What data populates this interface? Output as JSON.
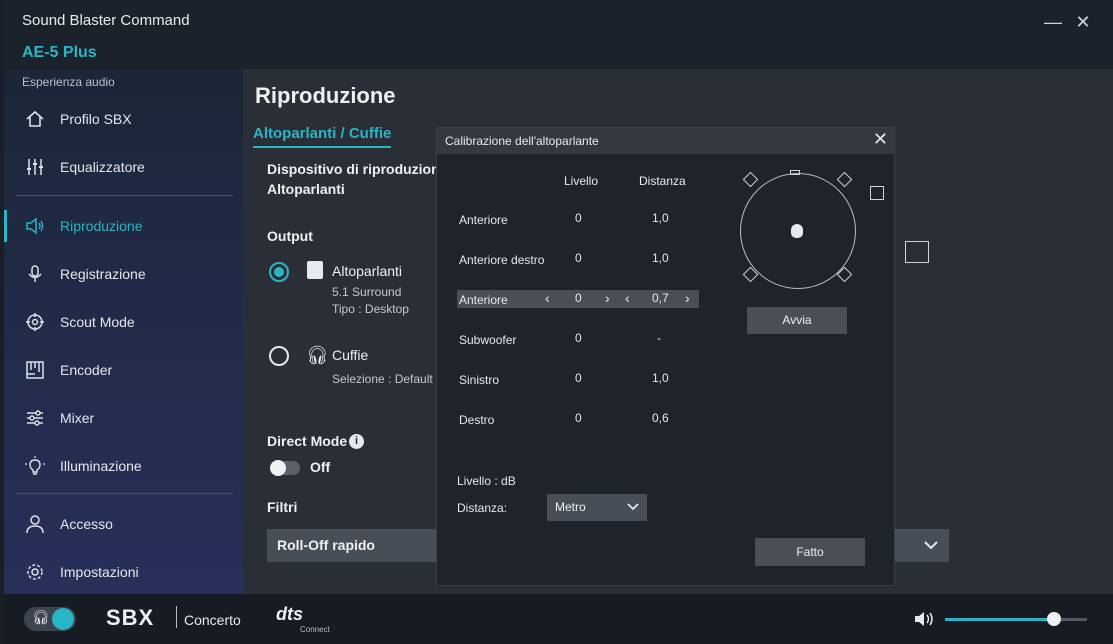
{
  "app": {
    "title": "Sound Blaster Command",
    "device": "AE-5 Plus",
    "minimize_glyph": "—",
    "close_glyph": "✕"
  },
  "sidebar": {
    "section_label": "Esperienza audio",
    "items": [
      {
        "label": "Profilo SBX",
        "icon": "home-icon"
      },
      {
        "label": "Equalizzatore",
        "icon": "equalizer-icon"
      },
      {
        "label": "Riproduzione",
        "icon": "speaker-icon",
        "active": true
      },
      {
        "label": "Registrazione",
        "icon": "microphone-icon"
      },
      {
        "label": "Scout Mode",
        "icon": "crosshair-icon"
      },
      {
        "label": "Encoder",
        "icon": "encoder-icon"
      },
      {
        "label": "Mixer",
        "icon": "mixer-icon"
      },
      {
        "label": "Illuminazione",
        "icon": "lightbulb-icon"
      },
      {
        "label": "Accesso",
        "icon": "user-icon"
      },
      {
        "label": "Impostazioni",
        "icon": "gear-icon"
      }
    ]
  },
  "main": {
    "title": "Riproduzione",
    "tab_active": "Altoparlanti / Cuffie",
    "device_label": "Dispositivo di riproduzione:",
    "device_value": "Altoparlanti",
    "output_label": "Output",
    "speakers": {
      "label": "Altoparlanti",
      "line1": "5.1 Surround",
      "line2": "Tipo :  Desktop"
    },
    "headphones": {
      "label": "Cuffie",
      "line1": "Selezione :  Default"
    },
    "direct_mode_label": "Direct Mode",
    "direct_mode_value": "Off",
    "filters_label": "Filtri",
    "filter_value": "Roll-Off rapido"
  },
  "dialog": {
    "title": "Calibrazione dell'altoparlante",
    "col_level": "Livello",
    "col_distance": "Distanza",
    "rows": [
      {
        "name": "Anteriore",
        "level": "0",
        "distance": "1,0"
      },
      {
        "name": "Anteriore destro",
        "level": "0",
        "distance": "1,0"
      },
      {
        "name": "Anteriore",
        "level": "0",
        "distance": "0,7"
      },
      {
        "name": "Subwoofer",
        "level": "0",
        "distance": "-"
      },
      {
        "name": "Sinistro",
        "level": "0",
        "distance": "1,0"
      },
      {
        "name": "Destro",
        "level": "0",
        "distance": "0,6"
      }
    ],
    "level_unit": "Livello : dB",
    "distance_label": "Distanza:",
    "distance_unit": "Metro",
    "start_button": "Avvia",
    "done_button": "Fatto"
  },
  "bottom": {
    "mode": "Concerto",
    "sbx": "SBX",
    "dts": "dts",
    "dts_sub": "Connect",
    "volume": 0.77
  }
}
